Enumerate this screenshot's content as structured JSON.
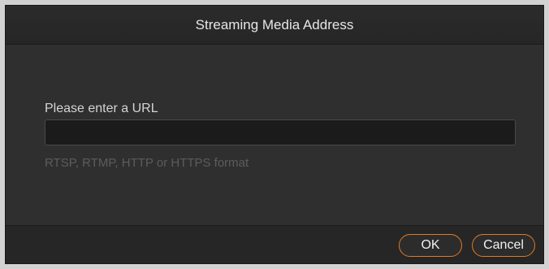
{
  "dialog": {
    "title": "Streaming Media Address",
    "prompt_label": "Please enter a URL",
    "url_value": "",
    "hint": "RTSP, RTMP, HTTP or HTTPS format",
    "ok_label": "OK",
    "cancel_label": "Cancel"
  },
  "colors": {
    "accent": "#e07a22",
    "background": "#303030",
    "input_background": "#1b1b1b"
  }
}
